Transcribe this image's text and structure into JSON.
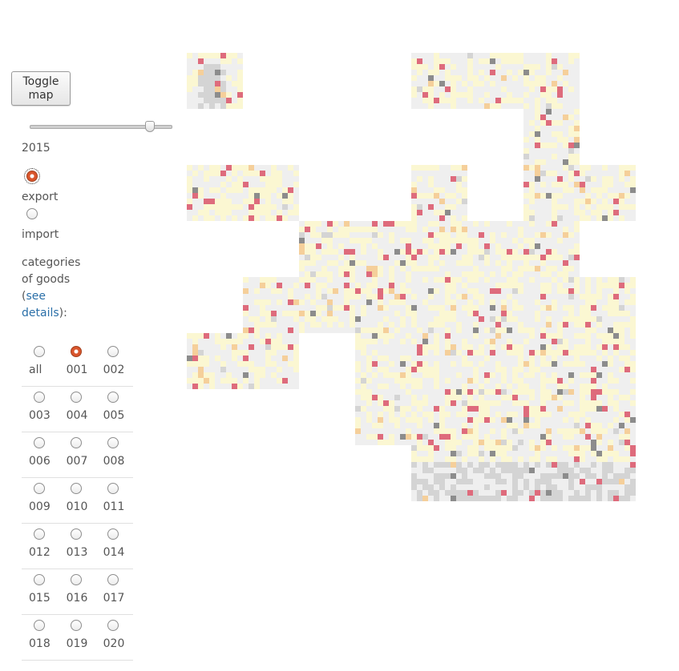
{
  "toggle_button": "Toggle map",
  "year": "2015",
  "slider": {
    "value": 2015,
    "min": 1995,
    "max": 2016
  },
  "flow_options": [
    {
      "label": "export",
      "checked": true
    },
    {
      "label": "import",
      "checked": false
    }
  ],
  "categories": {
    "label_start": "categories of goods (",
    "link": "see details",
    "label_end": "):"
  },
  "category_options": [
    "all",
    "001",
    "002",
    "003",
    "004",
    "005",
    "006",
    "007",
    "008",
    "009",
    "010",
    "011",
    "012",
    "013",
    "014",
    "015",
    "016",
    "017",
    "018",
    "019",
    "020"
  ],
  "selected_category": "001",
  "colors": {
    "land": "#efefef",
    "land_dark": "#d4d4d4",
    "low": "#fbf7d2",
    "medium": "#f5cf9a",
    "high": "#de6b7c",
    "missing": "#8c8c8c",
    "accent": "#d9552c",
    "link": "#2a6fa8"
  }
}
